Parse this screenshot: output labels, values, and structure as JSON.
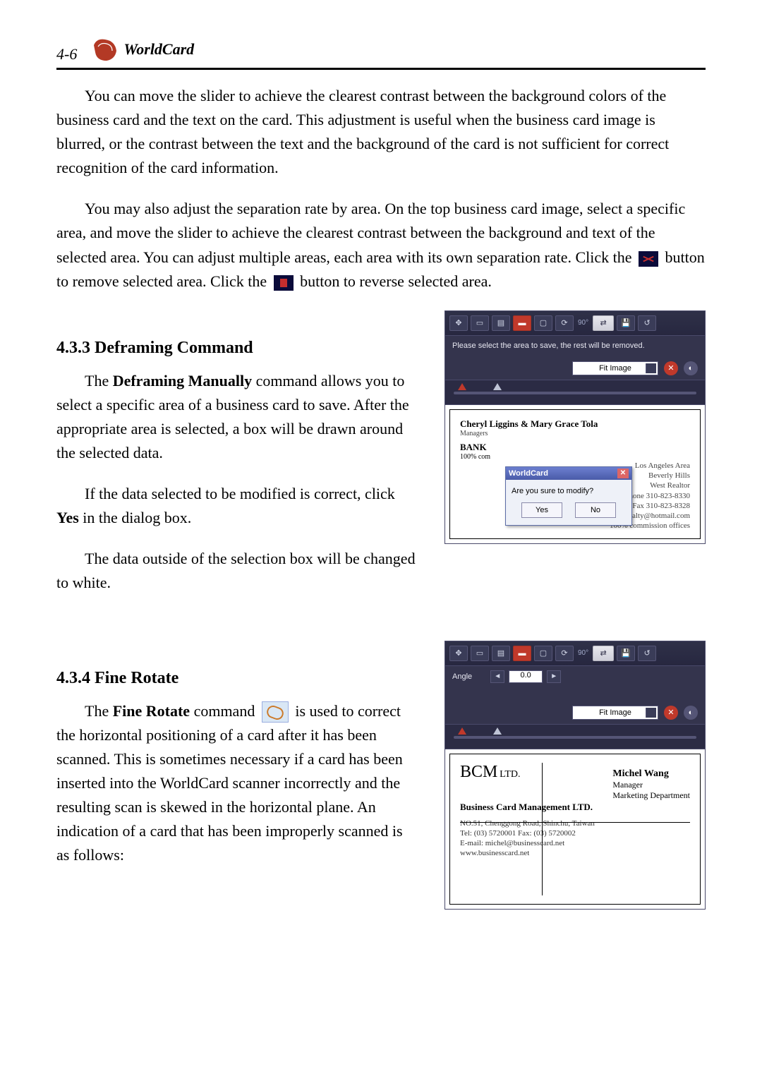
{
  "header": {
    "page_number": "4-6",
    "product": "WorldCard"
  },
  "paragraphs": {
    "p1": "You can  move the slider to achieve the clearest contrast between the background colors of the business card and the text on the card. This adjustment is useful when the business card image is blurred, or the contrast between the text and the background of the card is not sufficient for correct recognition of the card information.",
    "p2a": "You may also adjust the separation rate by area. On the top business card image, select a specific area, and move the slider to achieve the clearest contrast between the background and text of the selected area. You can adjust multiple areas, each area with its own separation rate. Click the ",
    "p2b": " button to remove selected area. Click the ",
    "p2c": " button to reverse selected area."
  },
  "section433": {
    "heading": "4.3.3 Deframing Command",
    "p1a": "The ",
    "p1b": "Deframing Manually",
    "p1c": " command allows you to select a specific area of a business card to save. After the appropriate area is selected, a box will be drawn around the selected data.",
    "p2a": "If the data selected to be modified is correct, click ",
    "p2b": "Yes",
    "p2c": " in the dialog box.",
    "p3": "The data outside of the selection box will be changed to white."
  },
  "section434": {
    "heading": "4.3.4 Fine Rotate",
    "p1a": "The ",
    "p1b": "Fine Rotate",
    "p1c": " command ",
    "p1d": " is used to correct the horizontal positioning of a card after it has been scanned. This is sometimes necessary if a card has been inserted into the WorldCard scanner incorrectly and the resulting scan is skewed in the horizontal plane. An indication of a card that has been improperly scanned is as follows:"
  },
  "panel1": {
    "rot_label": "90°",
    "status_text": "Please select the area to save, the rest will be removed.",
    "fit_label": "Fit Image",
    "card_name": "Cheryl Liggins & Mary Grace Tola",
    "card_sub": "Managers",
    "bank_word": "BANK",
    "pct": "100% com",
    "right_lines": {
      "l1": "Los Angeles Area",
      "l2": "Beverly Hills",
      "l3": "West Realtor",
      "l4": "Phone 310-823-8330",
      "l5": "Fax 310-823-8328",
      "l6": "E-mail:barkersrealty@hotmail.com",
      "l7": "100% commission offices"
    },
    "dialog": {
      "title": "WorldCard",
      "msg": "Are you sure to modify?",
      "yes": "Yes",
      "no": "No"
    }
  },
  "panel2": {
    "rot_label": "90°",
    "angle_label": "Angle",
    "angle_value": "0.0",
    "fit_label": "Fit Image",
    "card": {
      "logo": "BCM",
      "ltd": "LTD.",
      "name": "Michel Wang",
      "title": "Manager",
      "dept": "Marketing Department",
      "company": "Business Card Management  LTD.",
      "addr": "NO.51, Chenggong Road, Shinchu, Taiwan",
      "tel": "Tel: (03) 5720001      Fax: (03) 5720002",
      "email": "E-mail: michel@businesscard.net",
      "web": "www.businesscard.net"
    }
  }
}
